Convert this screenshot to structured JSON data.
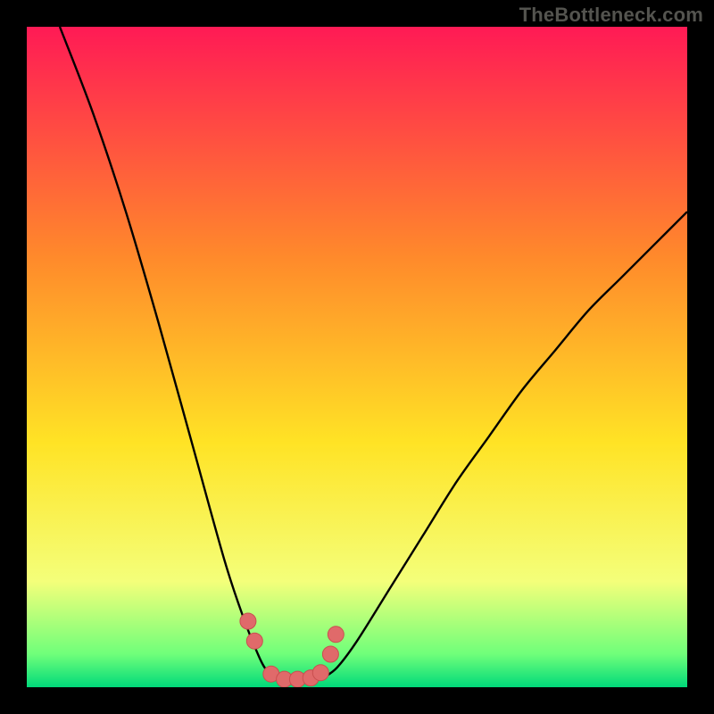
{
  "watermark": "TheBottleneck.com",
  "colors": {
    "top": "#ff1a55",
    "upper_mid": "#ff8a2b",
    "mid": "#ffe325",
    "lower_mid": "#f4ff7a",
    "near_bottom": "#6fff7a",
    "bottom": "#00d97a",
    "curve": "#000000",
    "marker_fill": "#e06a6a",
    "marker_stroke": "#c94f4f"
  },
  "chart_data": {
    "type": "line",
    "title": "",
    "xlabel": "",
    "ylabel": "",
    "xlim": [
      0,
      100
    ],
    "ylim": [
      0,
      100
    ],
    "series": [
      {
        "name": "left-curve",
        "x": [
          5,
          10,
          15,
          20,
          25,
          30,
          33,
          35,
          36,
          37,
          38
        ],
        "values": [
          100,
          87,
          72,
          55,
          37,
          19,
          10,
          5,
          3,
          2,
          1.5
        ]
      },
      {
        "name": "valley-floor",
        "x": [
          37,
          39,
          41,
          43,
          45
        ],
        "values": [
          1.5,
          1,
          1,
          1.2,
          1.5
        ]
      },
      {
        "name": "right-curve",
        "x": [
          45,
          47,
          50,
          55,
          60,
          65,
          70,
          75,
          80,
          85,
          90,
          95,
          100
        ],
        "values": [
          1.5,
          3,
          7,
          15,
          23,
          31,
          38,
          45,
          51,
          57,
          62,
          67,
          72
        ]
      }
    ],
    "markers": {
      "name": "valley-markers",
      "x": [
        33.5,
        34.5,
        37,
        39,
        41,
        43,
        44.5,
        46,
        46.8
      ],
      "values": [
        10,
        7,
        2,
        1.2,
        1.2,
        1.4,
        2.2,
        5,
        8
      ],
      "size": 9
    }
  }
}
